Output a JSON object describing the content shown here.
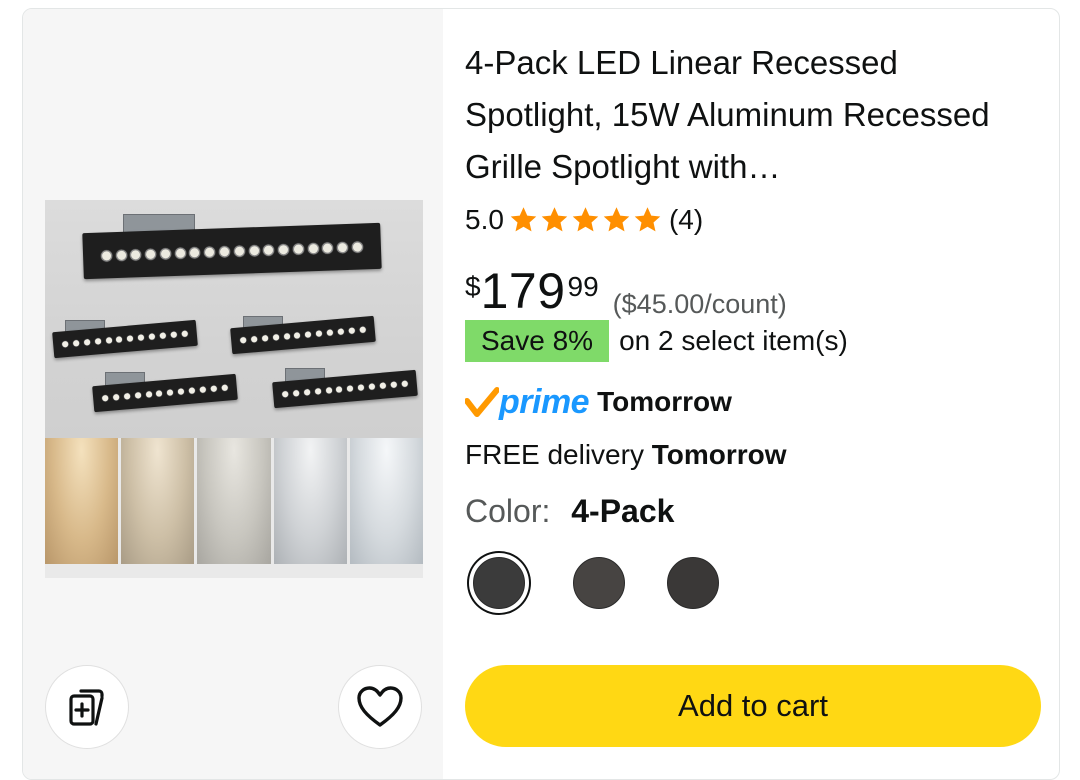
{
  "product": {
    "title": "4-Pack LED Linear Recessed Spotlight, 15W Aluminum Recessed Grille Spotlight with…",
    "rating": "5.0",
    "rating_value": 5,
    "review_count": "(4)",
    "price": {
      "symbol": "$",
      "whole": "179",
      "fraction": "99",
      "unit_price": "($45.00/count)"
    },
    "save": {
      "badge": "Save 8%",
      "text": "on 2 select item(s)"
    },
    "prime": {
      "logo_word": "prime",
      "delivery_day": "Tomorrow"
    },
    "delivery": {
      "prefix": "FREE delivery",
      "day": "Tomorrow"
    },
    "color": {
      "label": "Color:",
      "selected": "4-Pack",
      "options": [
        "4-Pack",
        "option-2",
        "option-3"
      ]
    }
  },
  "actions": {
    "add_to_cart": "Add to cart"
  },
  "icons": {
    "compare": "add-to-compare-icon",
    "wishlist": "heart-icon",
    "star": "star-icon",
    "prime_check": "prime-check-icon"
  },
  "colors": {
    "star": "#ff8f00",
    "prime_blue": "#1a98ff",
    "prime_check": "#ff9900",
    "save_badge": "#7fda69",
    "cart_button": "#ffd814"
  }
}
